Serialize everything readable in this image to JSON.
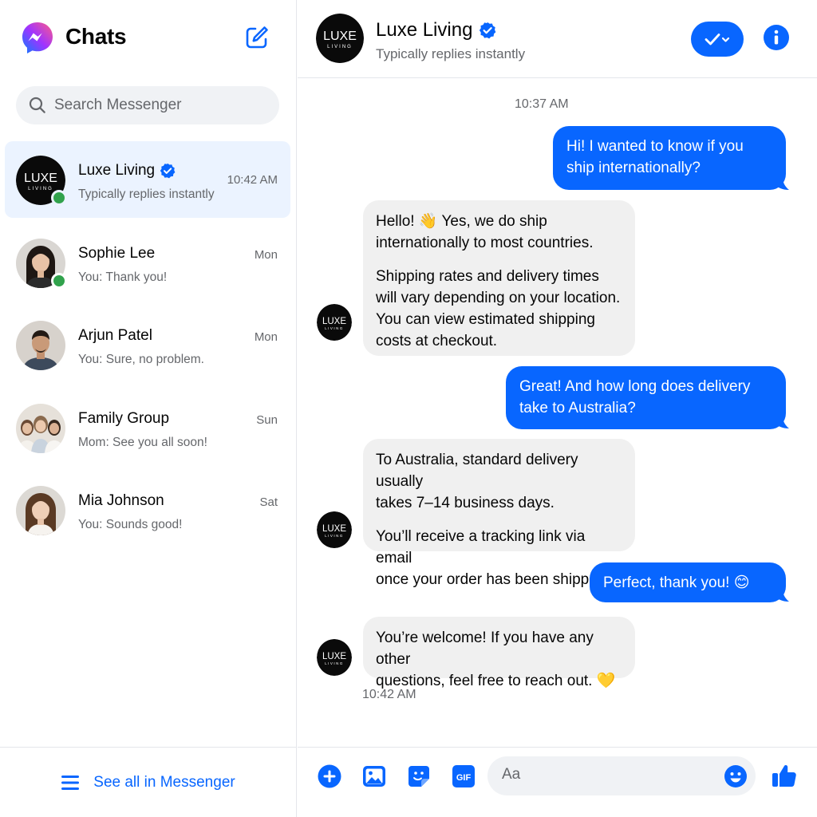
{
  "sidebar": {
    "title": "Chats",
    "search": {
      "placeholder": "Search Messenger"
    },
    "chats": [
      {
        "name": "Luxe Living",
        "verified": true,
        "preview": "Typically replies instantly",
        "time": "10:42 AM",
        "online": true,
        "active": true,
        "avatar": "luxe-living-logo"
      },
      {
        "name": "Sophie Lee",
        "preview": "You: Thank you!",
        "time": "Mon",
        "online": true,
        "avatar": "sophie-lee-photo"
      },
      {
        "name": "Arjun Patel",
        "preview": "You: Sure, no problem.",
        "time": "Mon",
        "online": false,
        "avatar": "arjun-patel-photo"
      },
      {
        "name": "Family Group",
        "preview": "Mom: See you all soon!",
        "time": "Sun",
        "online": false,
        "avatar": "family-group-photo"
      },
      {
        "name": "Mia Johnson",
        "preview": "You: Sounds good!",
        "time": "Sat",
        "online": false,
        "avatar": "mia-johnson-photo"
      }
    ],
    "footer_label": "See all in Messenger"
  },
  "conversation": {
    "name": "Luxe Living",
    "verified": true,
    "subtitle": "Typically replies instantly",
    "logo": {
      "line1": "LUXE",
      "line2": "LIVING"
    },
    "timestamp_top": "10:37 AM",
    "messages": [
      {
        "from": "me",
        "lines": [
          "Hi! I wanted to know if you",
          "ship internationally?"
        ]
      },
      {
        "from": "them",
        "paragraphs": [
          [
            "Hello! 👋 Yes, we do ship",
            "internationally to most countries."
          ],
          [
            "Shipping rates and delivery times",
            "will vary depending on your location.",
            "You can view estimated shipping",
            "costs at checkout."
          ]
        ]
      },
      {
        "from": "me",
        "lines": [
          "Great! And how long does delivery",
          "take to Australia?"
        ]
      },
      {
        "from": "them",
        "paragraphs": [
          [
            "To Australia, standard delivery usually",
            "takes 7–14 business days."
          ],
          [
            "You’ll receive a tracking link via email",
            "once your order has been shipped."
          ]
        ]
      },
      {
        "from": "me",
        "lines": [
          "Perfect, thank you! 😊"
        ]
      },
      {
        "from": "them",
        "paragraphs": [
          [
            "You’re welcome! If you have any other",
            "questions, feel free to reach out. 💛"
          ]
        ]
      }
    ],
    "timestamp_bottom": "10:42 AM",
    "composer": {
      "placeholder": "Aa"
    }
  },
  "colors": {
    "accent": "#0866ff",
    "online": "#31a24c",
    "bubble_in": "#f0f0f0",
    "active_row": "#ebf3ff",
    "muted_text": "#65676b"
  },
  "icons": [
    "messenger-logo",
    "compose-icon",
    "search-icon",
    "verified-badge-icon",
    "check-chevron-icon",
    "info-icon",
    "menu-icon",
    "plus-icon",
    "image-icon",
    "sticker-icon",
    "gif-icon",
    "emoji-icon",
    "thumbs-up-icon"
  ]
}
